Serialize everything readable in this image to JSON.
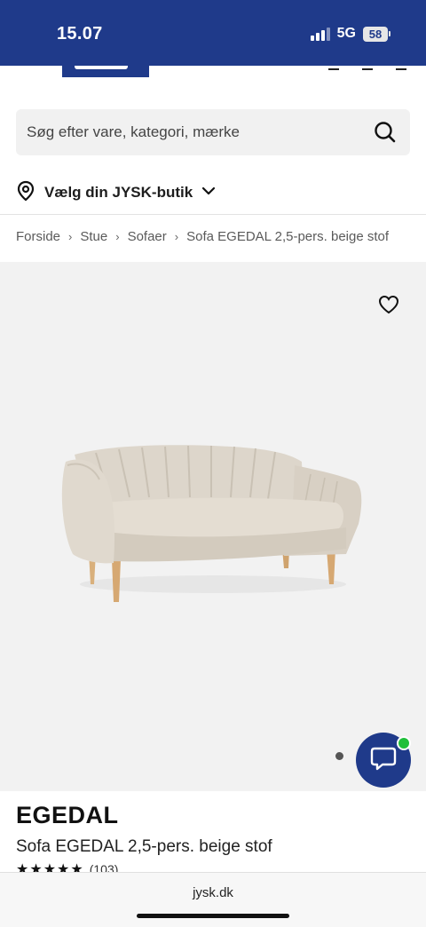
{
  "status_bar": {
    "time": "15.07",
    "network": "5G",
    "battery": "58"
  },
  "search": {
    "placeholder": "Søg efter vare, kategori, mærke"
  },
  "store": {
    "label": "Vælg din JYSK-butik"
  },
  "breadcrumb": {
    "items": [
      "Forside",
      "Stue",
      "Sofaer",
      "Sofa EGEDAL 2,5-pers. beige stof"
    ]
  },
  "product": {
    "brand": "EGEDAL",
    "name": "Sofa EGEDAL 2,5-pers. beige stof",
    "rating_stars": "★★★★★",
    "review_count": "(103)"
  },
  "colors": {
    "brand_blue": "#1f3a8a",
    "image_bg": "#f2f2f2",
    "online_green": "#1fbf3a"
  },
  "icons": {
    "search": "search-icon",
    "location": "location-pin-icon",
    "chevron": "chevron-down-icon",
    "wishlist": "heart-icon",
    "chat": "chat-bubble-icon"
  },
  "browser": {
    "url": "jysk.dk"
  }
}
